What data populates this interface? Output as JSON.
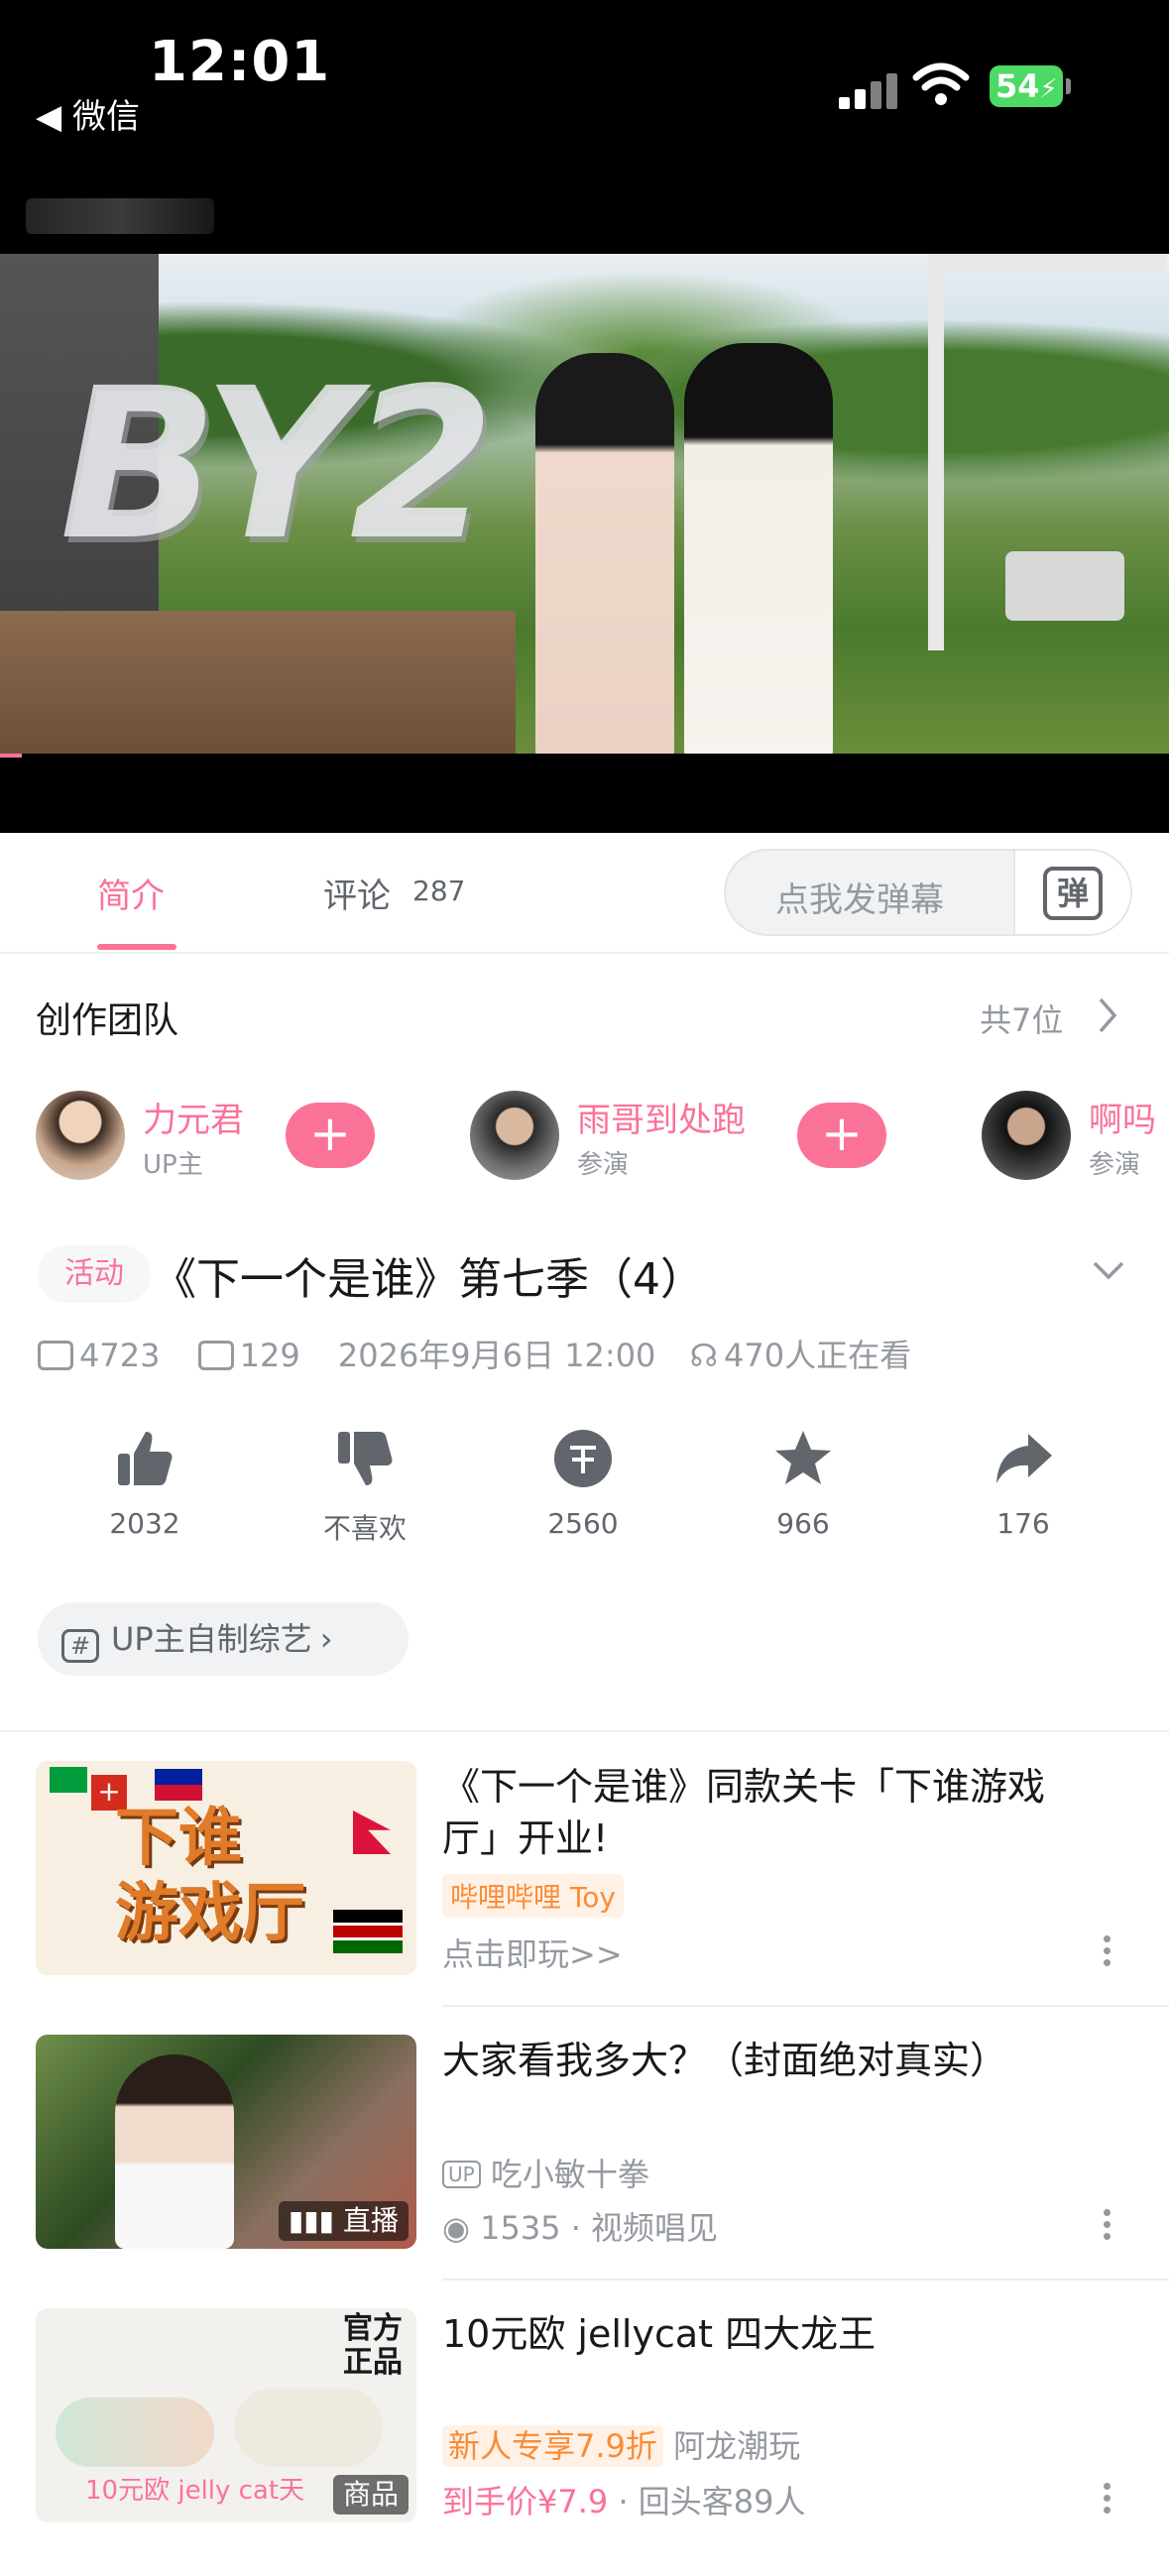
{
  "status_bar": {
    "time": "12:01",
    "back_app": "◀ 微信",
    "battery": "54"
  },
  "tabs": {
    "intro": "简介",
    "comments": "评论",
    "comments_count": "287"
  },
  "danmaku": {
    "placeholder": "点我发弹幕",
    "icon_text": "弹"
  },
  "video_logo": "BY2",
  "creators": {
    "title": "创作团队",
    "count": "共7位",
    "items": [
      {
        "name": "力元君",
        "role": "UP主"
      },
      {
        "name": "雨哥到处跑",
        "role": "参演"
      },
      {
        "name": "啊吗",
        "role": "参演"
      }
    ]
  },
  "video": {
    "tag": "活动",
    "title": "《下一个是谁》第七季（4）",
    "plays": "4723",
    "danmaku_count": "129",
    "date": "2026年9月6日 12:00",
    "watching": "470人正在看"
  },
  "actions": {
    "like": "2032",
    "dislike": "不喜欢",
    "coin": "2560",
    "favorite": "966",
    "share": "176"
  },
  "tag_chip": "UP主自制综艺",
  "recommendations": [
    {
      "thumb_text": "下谁\n游戏厅",
      "title": "《下一个是谁》同款关卡「下谁游戏厅」开业!",
      "badge": "哔哩哔哩 Toy",
      "line2": "点击即玩>>"
    },
    {
      "thumb_badge": "直播",
      "title": "大家看我多大？（封面绝对真实）",
      "up": "吃小敏十拳",
      "views": "1535",
      "views_suffix": "· 视频唱见"
    },
    {
      "thumb_corner": "官方\n正品",
      "thumb_caption": "10元欧 jelly cat天",
      "thumb_badge": "商品",
      "title": "10元欧 jellycat 四大龙王",
      "promo": "新人专享7.9折",
      "shop": "阿龙潮玩",
      "price": "到手价¥7.9",
      "repeat": "· 回头客89人"
    }
  ],
  "colors": {
    "accent": "#fb7299",
    "muted": "#9499a0"
  }
}
